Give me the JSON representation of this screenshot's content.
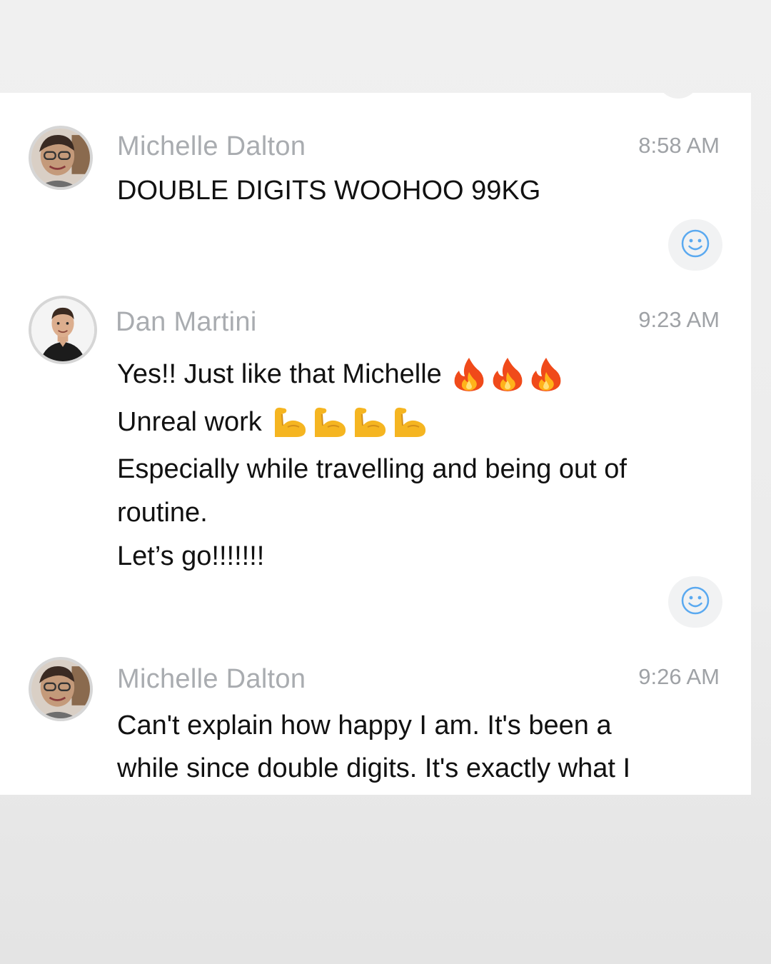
{
  "messages": [
    {
      "sender": "Michelle Dalton",
      "time": "8:58 AM",
      "lines": [
        "DOUBLE DIGITS WOOHOO 99KG"
      ]
    },
    {
      "sender": "Dan Martini",
      "time": "9:23 AM",
      "lines": [
        "Yes!! Just like that Michelle",
        "Unreal work",
        "Especially while travelling and being out of",
        "routine.",
        "Let’s go!!!!!!!"
      ],
      "emoji": {
        "line_0": [
          "fire-icon",
          "fire-icon",
          "fire-icon"
        ],
        "line_1": [
          "flexed-biceps-icon",
          "flexed-biceps-icon",
          "flexed-biceps-icon",
          "flexed-biceps-icon"
        ]
      }
    },
    {
      "sender": "Michelle Dalton",
      "time": "9:26 AM",
      "lines": [
        "Can't explain how happy I am. It's been a",
        "while since double digits. It's exactly what I"
      ]
    }
  ],
  "reaction_icon": "smiley-face-icon",
  "colors": {
    "reaction_accent": "#5aa9f0",
    "sender_name": "#a9acb0",
    "timestamp": "#9fa2a6",
    "message_text": "#111111"
  }
}
